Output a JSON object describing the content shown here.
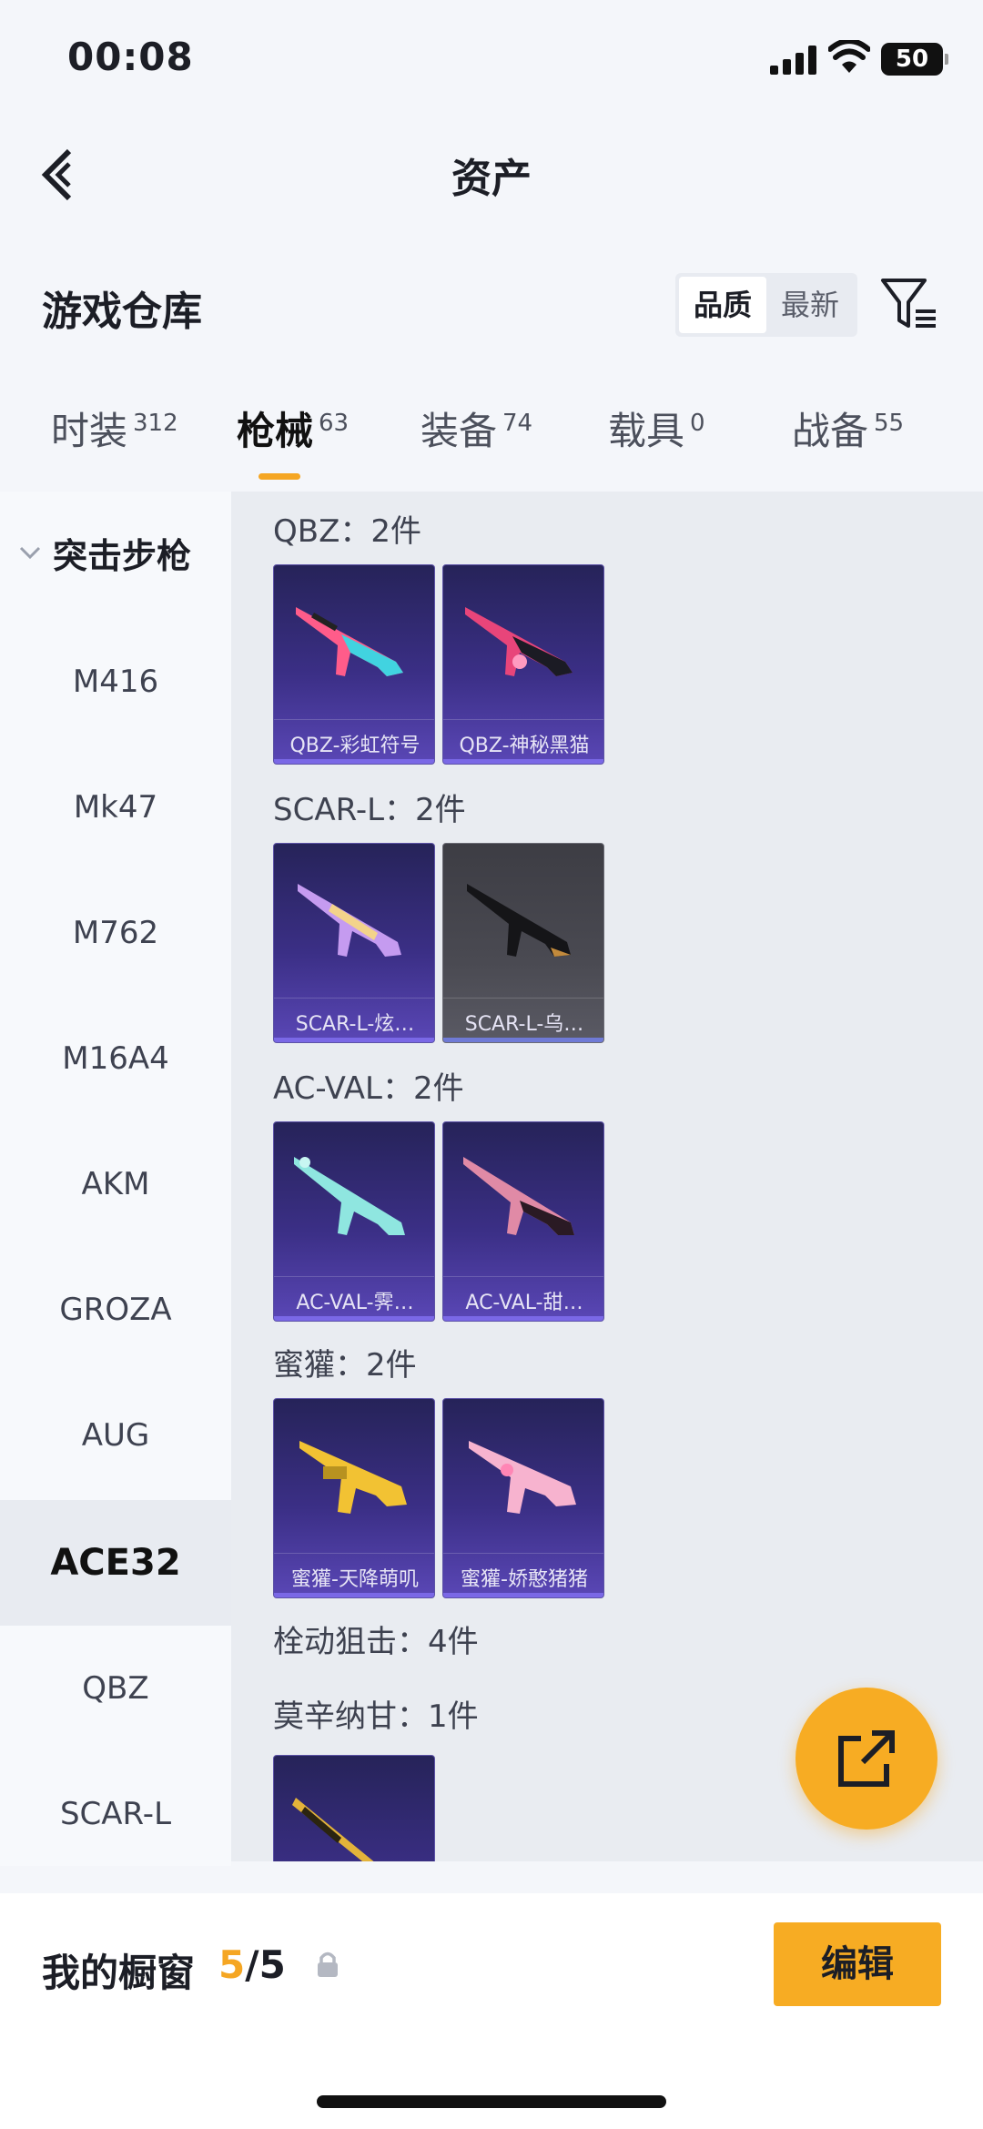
{
  "status_bar": {
    "time": "00:08",
    "battery": "50"
  },
  "nav": {
    "title": "资产"
  },
  "section": {
    "title": "游戏仓库",
    "sort_options": [
      "品质",
      "最新"
    ],
    "sort_selected": "品质"
  },
  "tabs": [
    {
      "label": "时装",
      "count": "312"
    },
    {
      "label": "枪械",
      "count": "63"
    },
    {
      "label": "装备",
      "count": "74"
    },
    {
      "label": "载具",
      "count": "0"
    },
    {
      "label": "战备",
      "count": "55"
    }
  ],
  "active_tab": "枪械",
  "sidebar": {
    "group": "突击步枪",
    "items": [
      "M416",
      "Mk47",
      "M762",
      "M16A4",
      "AKM",
      "GROZA",
      "AUG",
      "ACE32",
      "QBZ",
      "SCAR-L"
    ],
    "selected": "ACE32"
  },
  "content": {
    "groups": [
      {
        "label": "QBZ：2件",
        "items": [
          "QBZ-彩虹符号",
          "QBZ-神秘黑猫"
        ]
      },
      {
        "label": "SCAR-L：2件",
        "items": [
          "SCAR-L-炫…",
          "SCAR-L-乌…"
        ]
      },
      {
        "label": "AC-VAL：2件",
        "items": [
          "AC-VAL-霁…",
          "AC-VAL-甜…"
        ]
      },
      {
        "label": "蜜獾：2件",
        "items": [
          "蜜獾-天降萌叽",
          "蜜獾-娇憨猪猪"
        ]
      },
      {
        "label": "栓动狙击：4件",
        "items": []
      },
      {
        "label": "莫辛纳甘：1件",
        "items": [
          ""
        ]
      }
    ]
  },
  "bottom_bar": {
    "showcase_label": "我的橱窗",
    "count_current": "5",
    "count_total": "/5",
    "edit_label": "编辑"
  },
  "colors": {
    "accent": "#f5a623",
    "card_purple": "#3b2f86",
    "card_gray": "#4a4a52"
  },
  "icons": [
    "signal-icon",
    "wifi-icon",
    "back-arrow-icon",
    "filter-icon",
    "chevron-down-icon",
    "share-external-icon",
    "lock-icon"
  ]
}
